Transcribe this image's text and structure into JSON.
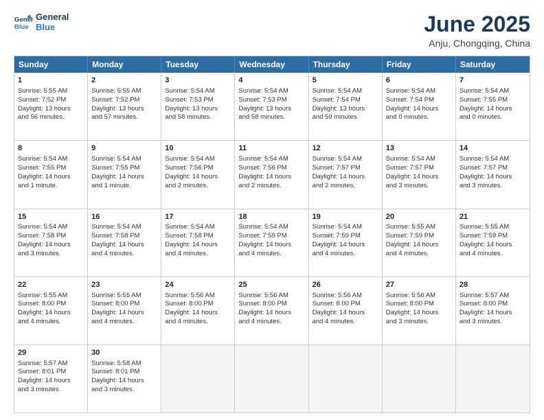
{
  "header": {
    "logo_line1": "General",
    "logo_line2": "Blue",
    "title": "June 2025",
    "subtitle": "Anju, Chongqing, China"
  },
  "weekdays": [
    "Sunday",
    "Monday",
    "Tuesday",
    "Wednesday",
    "Thursday",
    "Friday",
    "Saturday"
  ],
  "rows": [
    [
      {
        "day": "1",
        "lines": [
          "Sunrise: 5:55 AM",
          "Sunset: 7:52 PM",
          "Daylight: 13 hours",
          "and 56 minutes."
        ]
      },
      {
        "day": "2",
        "lines": [
          "Sunrise: 5:55 AM",
          "Sunset: 7:52 PM",
          "Daylight: 13 hours",
          "and 57 minutes."
        ]
      },
      {
        "day": "3",
        "lines": [
          "Sunrise: 5:54 AM",
          "Sunset: 7:53 PM",
          "Daylight: 13 hours",
          "and 58 minutes."
        ]
      },
      {
        "day": "4",
        "lines": [
          "Sunrise: 5:54 AM",
          "Sunset: 7:53 PM",
          "Daylight: 13 hours",
          "and 58 minutes."
        ]
      },
      {
        "day": "5",
        "lines": [
          "Sunrise: 5:54 AM",
          "Sunset: 7:54 PM",
          "Daylight: 13 hours",
          "and 59 minutes."
        ]
      },
      {
        "day": "6",
        "lines": [
          "Sunrise: 5:54 AM",
          "Sunset: 7:54 PM",
          "Daylight: 14 hours",
          "and 0 minutes."
        ]
      },
      {
        "day": "7",
        "lines": [
          "Sunrise: 5:54 AM",
          "Sunset: 7:55 PM",
          "Daylight: 14 hours",
          "and 0 minutes."
        ]
      }
    ],
    [
      {
        "day": "8",
        "lines": [
          "Sunrise: 5:54 AM",
          "Sunset: 7:55 PM",
          "Daylight: 14 hours",
          "and 1 minute."
        ]
      },
      {
        "day": "9",
        "lines": [
          "Sunrise: 5:54 AM",
          "Sunset: 7:55 PM",
          "Daylight: 14 hours",
          "and 1 minute."
        ]
      },
      {
        "day": "10",
        "lines": [
          "Sunrise: 5:54 AM",
          "Sunset: 7:56 PM",
          "Daylight: 14 hours",
          "and 2 minutes."
        ]
      },
      {
        "day": "11",
        "lines": [
          "Sunrise: 5:54 AM",
          "Sunset: 7:56 PM",
          "Daylight: 14 hours",
          "and 2 minutes."
        ]
      },
      {
        "day": "12",
        "lines": [
          "Sunrise: 5:54 AM",
          "Sunset: 7:57 PM",
          "Daylight: 14 hours",
          "and 2 minutes."
        ]
      },
      {
        "day": "13",
        "lines": [
          "Sunrise: 5:54 AM",
          "Sunset: 7:57 PM",
          "Daylight: 14 hours",
          "and 3 minutes."
        ]
      },
      {
        "day": "14",
        "lines": [
          "Sunrise: 5:54 AM",
          "Sunset: 7:57 PM",
          "Daylight: 14 hours",
          "and 3 minutes."
        ]
      }
    ],
    [
      {
        "day": "15",
        "lines": [
          "Sunrise: 5:54 AM",
          "Sunset: 7:58 PM",
          "Daylight: 14 hours",
          "and 3 minutes."
        ]
      },
      {
        "day": "16",
        "lines": [
          "Sunrise: 5:54 AM",
          "Sunset: 7:58 PM",
          "Daylight: 14 hours",
          "and 4 minutes."
        ]
      },
      {
        "day": "17",
        "lines": [
          "Sunrise: 5:54 AM",
          "Sunset: 7:58 PM",
          "Daylight: 14 hours",
          "and 4 minutes."
        ]
      },
      {
        "day": "18",
        "lines": [
          "Sunrise: 5:54 AM",
          "Sunset: 7:59 PM",
          "Daylight: 14 hours",
          "and 4 minutes."
        ]
      },
      {
        "day": "19",
        "lines": [
          "Sunrise: 5:54 AM",
          "Sunset: 7:59 PM",
          "Daylight: 14 hours",
          "and 4 minutes."
        ]
      },
      {
        "day": "20",
        "lines": [
          "Sunrise: 5:55 AM",
          "Sunset: 7:59 PM",
          "Daylight: 14 hours",
          "and 4 minutes."
        ]
      },
      {
        "day": "21",
        "lines": [
          "Sunrise: 5:55 AM",
          "Sunset: 7:59 PM",
          "Daylight: 14 hours",
          "and 4 minutes."
        ]
      }
    ],
    [
      {
        "day": "22",
        "lines": [
          "Sunrise: 5:55 AM",
          "Sunset: 8:00 PM",
          "Daylight: 14 hours",
          "and 4 minutes."
        ]
      },
      {
        "day": "23",
        "lines": [
          "Sunrise: 5:55 AM",
          "Sunset: 8:00 PM",
          "Daylight: 14 hours",
          "and 4 minutes."
        ]
      },
      {
        "day": "24",
        "lines": [
          "Sunrise: 5:56 AM",
          "Sunset: 8:00 PM",
          "Daylight: 14 hours",
          "and 4 minutes."
        ]
      },
      {
        "day": "25",
        "lines": [
          "Sunrise: 5:56 AM",
          "Sunset: 8:00 PM",
          "Daylight: 14 hours",
          "and 4 minutes."
        ]
      },
      {
        "day": "26",
        "lines": [
          "Sunrise: 5:56 AM",
          "Sunset: 8:00 PM",
          "Daylight: 14 hours",
          "and 4 minutes."
        ]
      },
      {
        "day": "27",
        "lines": [
          "Sunrise: 5:56 AM",
          "Sunset: 8:00 PM",
          "Daylight: 14 hours",
          "and 3 minutes."
        ]
      },
      {
        "day": "28",
        "lines": [
          "Sunrise: 5:57 AM",
          "Sunset: 8:00 PM",
          "Daylight: 14 hours",
          "and 3 minutes."
        ]
      }
    ],
    [
      {
        "day": "29",
        "lines": [
          "Sunrise: 5:57 AM",
          "Sunset: 8:01 PM",
          "Daylight: 14 hours",
          "and 3 minutes."
        ]
      },
      {
        "day": "30",
        "lines": [
          "Sunrise: 5:58 AM",
          "Sunset: 8:01 PM",
          "Daylight: 14 hours",
          "and 3 minutes."
        ]
      },
      {
        "day": "",
        "lines": []
      },
      {
        "day": "",
        "lines": []
      },
      {
        "day": "",
        "lines": []
      },
      {
        "day": "",
        "lines": []
      },
      {
        "day": "",
        "lines": []
      }
    ]
  ]
}
